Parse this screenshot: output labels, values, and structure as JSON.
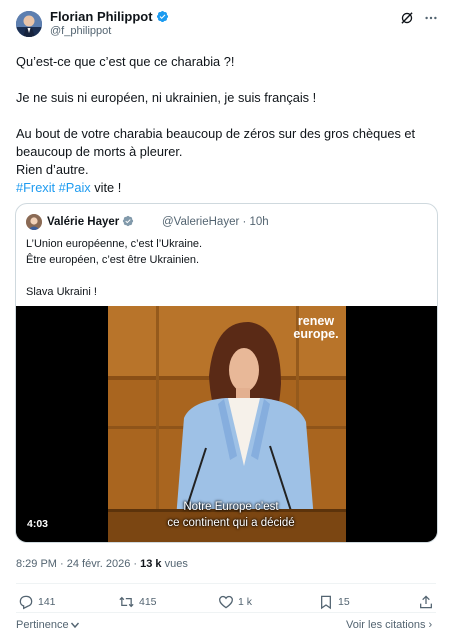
{
  "author": {
    "name": "Florian Philippot",
    "handle": "@f_philippot"
  },
  "tweet": {
    "line1": "Qu’est-ce que c’est que ce charabia ?!",
    "line2": "Je ne suis ni européen, ni ukrainien, je suis français !",
    "line3": "Au bout de votre charabia beaucoup de zéros sur des gros chèques et beaucoup de morts à pleurer.",
    "line4": "Rien d’autre.",
    "hashtag1": "#Frexit",
    "hashtag2": "#Paix",
    "line5_tail": " vite !"
  },
  "quote": {
    "name": "Valérie Hayer",
    "handle_time": "@ValerieHayer · 10h",
    "line1": "L’Union européenne, c’est l’Ukraine.",
    "line2": "Être européen, c’est être Ukrainien.",
    "line3": "Slava Ukraini !",
    "video": {
      "brand_line1": "renew",
      "brand_line2": "europe.",
      "caption_line1": "Notre Europe c’est",
      "caption_line2": "ce continent qui a décidé",
      "duration": "4:03"
    }
  },
  "meta": {
    "time": "8:29 PM · 24 févr. 2026 · ",
    "views_count": "13 k",
    "views_label": " vues"
  },
  "actions": {
    "replies": "141",
    "reposts": "415",
    "likes": "1 k",
    "bookmarks": "15"
  },
  "footer": {
    "relevance": "Pertinence",
    "citations": "Voir les citations ›"
  },
  "colors": {
    "accent": "#1d9bf0",
    "text": "#0f1419",
    "muted": "#536471"
  }
}
